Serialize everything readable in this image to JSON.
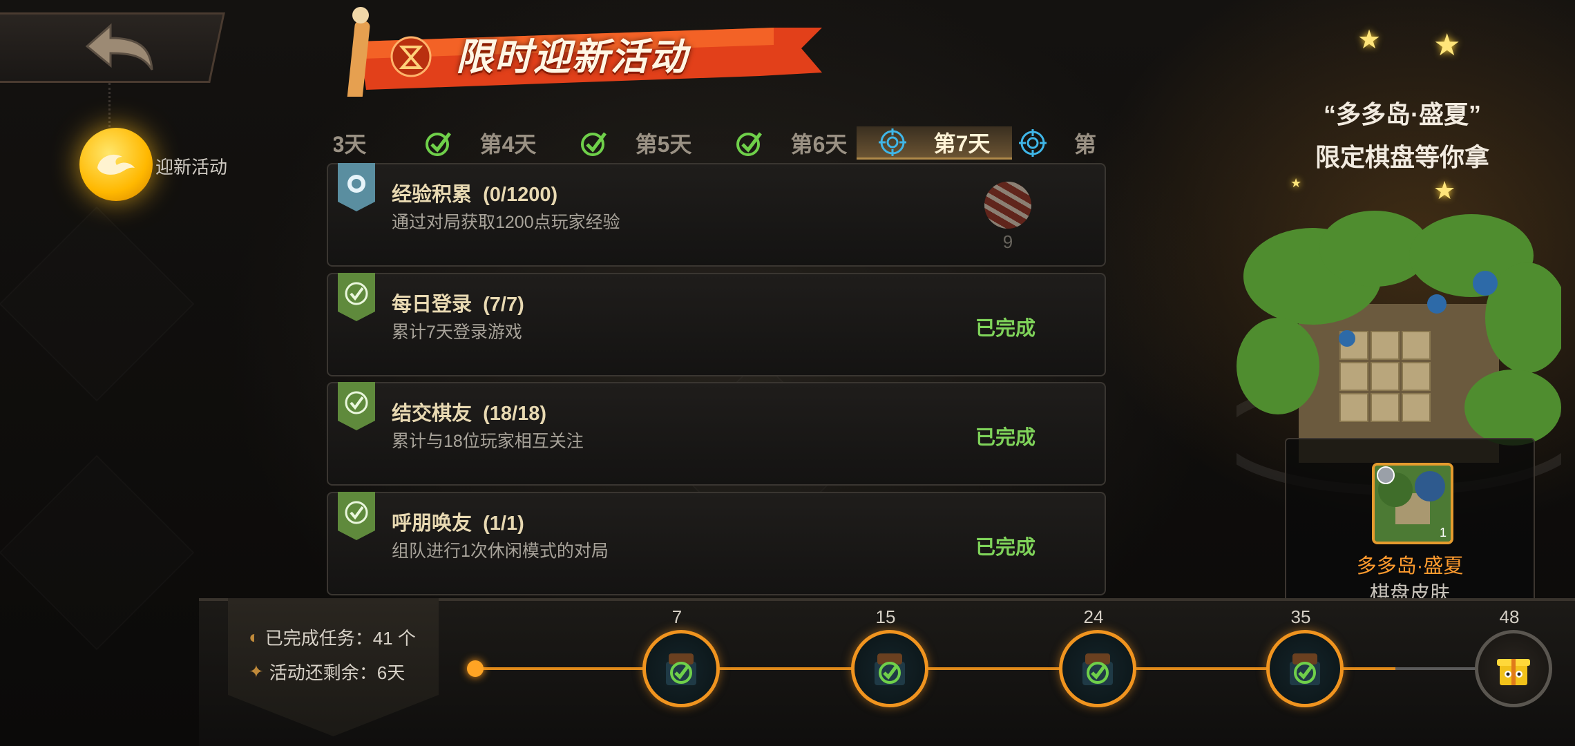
{
  "header": {
    "banner_title": "限时迎新活动"
  },
  "sidebar": {
    "event_label": "迎新活动"
  },
  "tabs": [
    {
      "label": "3天",
      "state": "partial"
    },
    {
      "label": "第4天",
      "state": "complete"
    },
    {
      "label": "第5天",
      "state": "complete"
    },
    {
      "label": "第6天",
      "state": "complete"
    },
    {
      "label": "第7天",
      "state": "active"
    },
    {
      "label": "第",
      "state": "target"
    }
  ],
  "tasks": [
    {
      "title": "经验积累",
      "progress": "(0/1200)",
      "desc": "通过对局获取1200点玩家经验",
      "status": "",
      "reward_count": "9"
    },
    {
      "title": "每日登录",
      "progress": "(7/7)",
      "desc": "累计7天登录游戏",
      "status": "已完成"
    },
    {
      "title": "结交棋友",
      "progress": "(18/18)",
      "desc": "累计与18位玩家相互关注",
      "status": "已完成"
    },
    {
      "title": "呼朋唤友",
      "progress": "(1/1)",
      "desc": "组队进行1次休闲模式的对局",
      "status": "已完成"
    }
  ],
  "promo": {
    "line1": "“多多岛·盛夏”",
    "line2": "限定棋盘等你拿"
  },
  "reward": {
    "name": "多多岛·盛夏",
    "type": "棋盘皮肤",
    "qty": "1"
  },
  "stats": {
    "completed_label": "已完成任务：41 个",
    "remaining_label": "活动还剩余：6天"
  },
  "milestones": [
    {
      "value": "7",
      "claimed": true
    },
    {
      "value": "15",
      "claimed": true
    },
    {
      "value": "24",
      "claimed": true
    },
    {
      "value": "35",
      "claimed": true
    },
    {
      "value": "48",
      "claimed": false
    }
  ],
  "colors": {
    "accent_orange": "#f0941f",
    "complete_green": "#7fd35a",
    "reward_name": "#ff9b2e"
  }
}
